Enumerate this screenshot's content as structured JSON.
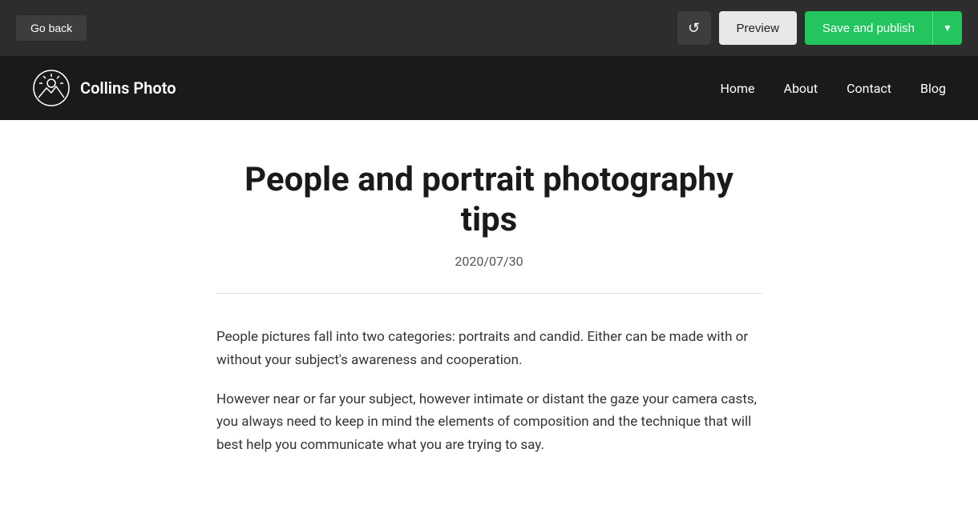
{
  "toolbar": {
    "go_back_label": "Go back",
    "preview_label": "Preview",
    "save_publish_label": "Save and publish",
    "history_icon": "↺"
  },
  "site_nav": {
    "logo_name": "Collins Photo",
    "menu_items": [
      {
        "label": "Home",
        "href": "#"
      },
      {
        "label": "About",
        "href": "#"
      },
      {
        "label": "Contact",
        "href": "#"
      },
      {
        "label": "Blog",
        "href": "#"
      }
    ]
  },
  "article": {
    "title": "People and portrait photography tips",
    "date": "2020/07/30",
    "paragraphs": [
      "People pictures fall into two categories: portraits and candid. Either can be made with or without your subject's awareness and cooperation.",
      "However near or far your subject, however intimate or distant the gaze your camera casts, you always need to keep in mind the elements of composition and the technique that will best help you communicate what you are trying to say."
    ]
  }
}
